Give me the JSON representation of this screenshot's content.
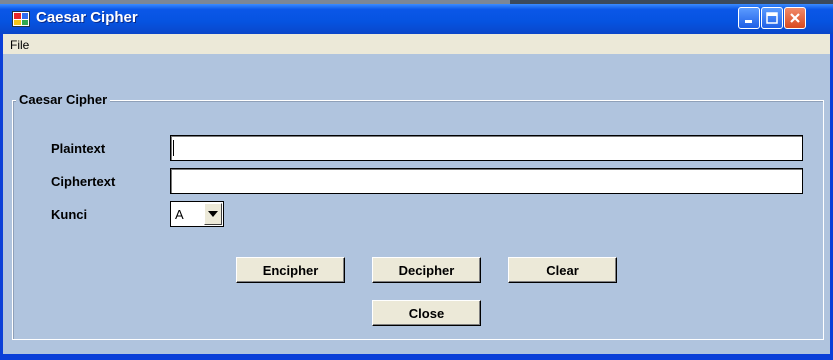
{
  "window": {
    "title": "Caesar Cipher",
    "controls": [
      "minimize",
      "maximize",
      "close"
    ]
  },
  "menu": {
    "items": [
      "File"
    ]
  },
  "group": {
    "title": "Caesar Cipher"
  },
  "form": {
    "plaintext_label": "Plaintext",
    "plaintext_value": "",
    "ciphertext_label": "Ciphertext",
    "ciphertext_value": "",
    "kunci_label": "Kunci",
    "kunci_value": "A"
  },
  "buttons": {
    "encipher": "Encipher",
    "decipher": "Decipher",
    "clear": "Clear",
    "close": "Close"
  },
  "icons": {
    "app": "app-icon",
    "minimize": "minimize-icon",
    "maximize": "maximize-icon",
    "close": "close-icon",
    "dropdown": "dropdown-arrow-icon"
  },
  "colors": {
    "titlebar": "#0653e0",
    "client_bg": "#b0c4de",
    "close_button": "#d94a20",
    "button_face": "#ece9d8"
  }
}
